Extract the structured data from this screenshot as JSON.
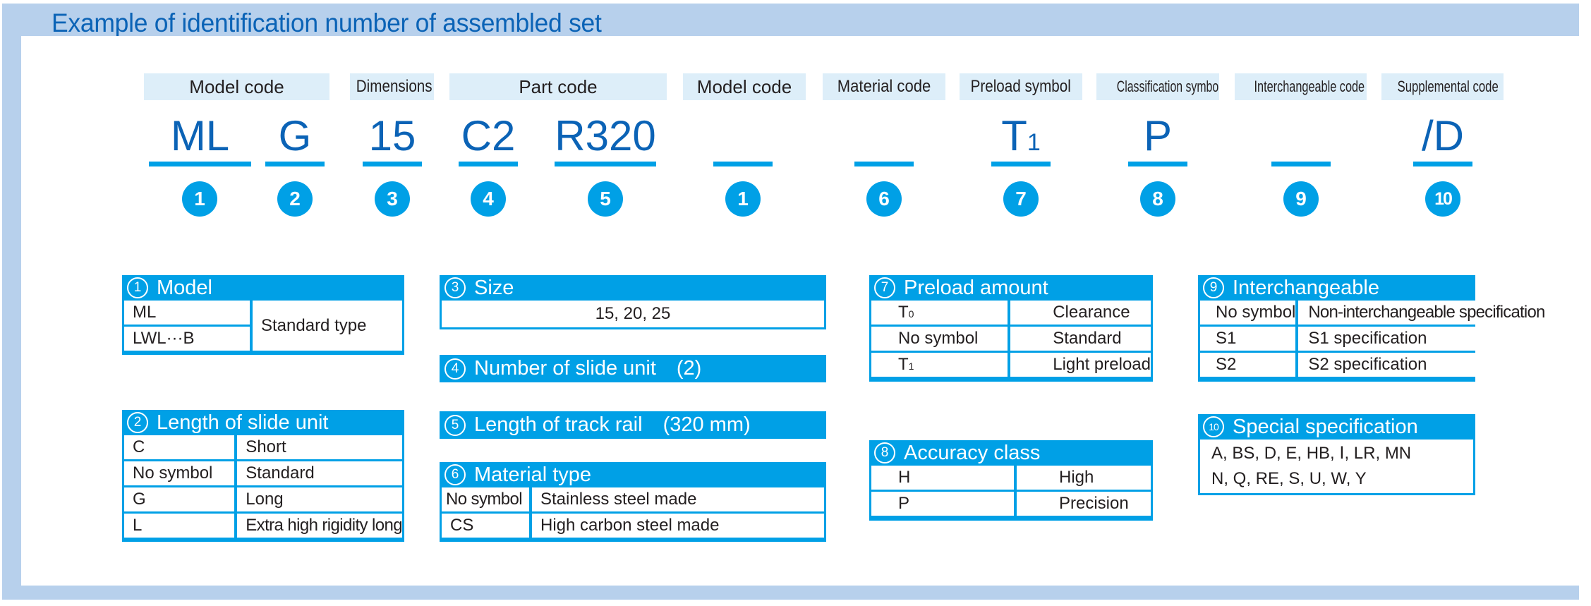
{
  "title": "Example of identification number of assembled set",
  "code_labels": [
    {
      "text": "Model code"
    },
    {
      "text": "Dimensions"
    },
    {
      "text": "Part code"
    },
    {
      "text": "Model code"
    },
    {
      "text": "Material code"
    },
    {
      "text": "Preload symbol"
    },
    {
      "text": "Classification symbol"
    },
    {
      "text": "Interchangeable code"
    },
    {
      "text": "Supplemental code"
    }
  ],
  "code_values": [
    {
      "text": "ML",
      "sub": "",
      "number": "1"
    },
    {
      "text": "G",
      "sub": "",
      "number": "2"
    },
    {
      "text": "15",
      "sub": "",
      "number": "3"
    },
    {
      "text": "C2",
      "sub": "",
      "number": "4"
    },
    {
      "text": "R320",
      "sub": "",
      "number": "5"
    },
    {
      "text": "",
      "sub": "",
      "number": "1"
    },
    {
      "text": "",
      "sub": "",
      "number": "6"
    },
    {
      "text": "T",
      "sub": "1",
      "number": "7"
    },
    {
      "text": "P",
      "sub": "",
      "number": "8"
    },
    {
      "text": "",
      "sub": "",
      "number": "9"
    },
    {
      "text": "/D",
      "sub": "",
      "number": "10"
    }
  ],
  "tables": {
    "model": {
      "number": "1",
      "title": "Model",
      "rows": [
        [
          "ML"
        ],
        [
          "LWL···B"
        ]
      ],
      "merged_value": "Standard type"
    },
    "length_slide_unit": {
      "number": "2",
      "title": "Length of slide unit",
      "rows": [
        [
          "C",
          "Short"
        ],
        [
          "No symbol",
          "Standard"
        ],
        [
          "G",
          "Long"
        ],
        [
          "L",
          "Extra high rigidity long"
        ]
      ]
    },
    "size": {
      "number": "3",
      "title": "Size",
      "value": "15, 20, 25"
    },
    "number_slide_unit": {
      "number": "4",
      "title": "Number of slide unit　(2)"
    },
    "length_track_rail": {
      "number": "5",
      "title": "Length of track rail　(320 mm)"
    },
    "material_type": {
      "number": "6",
      "title": "Material type",
      "rows": [
        [
          "No symbol",
          "Stainless steel made"
        ],
        [
          "CS",
          "High carbon steel made"
        ]
      ]
    },
    "preload_amount": {
      "number": "7",
      "title": "Preload amount",
      "rows": [
        {
          "sym": "T",
          "sub": "0",
          "desc": "Clearance"
        },
        {
          "sym": "No symbol",
          "sub": "",
          "desc": "Standard"
        },
        {
          "sym": "T",
          "sub": "1",
          "desc": "Light preload"
        }
      ]
    },
    "accuracy_class": {
      "number": "8",
      "title": "Accuracy class",
      "rows": [
        [
          "H",
          "High"
        ],
        [
          "P",
          "Precision"
        ]
      ]
    },
    "interchangeable": {
      "number": "9",
      "title": "Interchangeable",
      "rows": [
        [
          "No symbol",
          "Non-interchangeable specification"
        ],
        [
          "S1",
          "S1 specification"
        ],
        [
          "S2",
          "S2 specification"
        ]
      ]
    },
    "special_specification": {
      "number": "10",
      "title": "Special specification",
      "lines": [
        "A, BS, D, E, HB, Ⅰ, LR, MN",
        "N, Q, RE, S, U, W, Y"
      ]
    }
  },
  "colors": {
    "accent": "#00a0e6",
    "title_blue": "#0b63b6",
    "frame": "#b7d0ec",
    "label_bg": "#ddeef9"
  }
}
